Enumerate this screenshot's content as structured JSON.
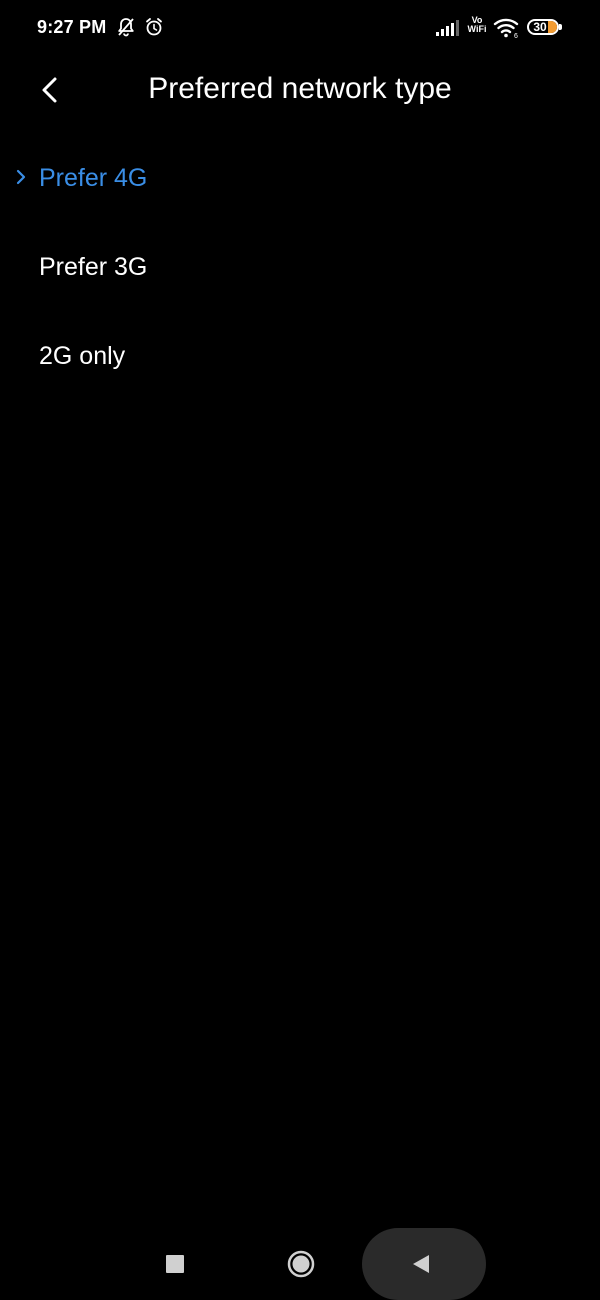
{
  "status_bar": {
    "time": "9:27 PM",
    "vowifi_line1": "Vo",
    "vowifi_line2": "WiFi",
    "battery_level": "30",
    "battery_accent": "#f39c32"
  },
  "header": {
    "title": "Preferred network type",
    "back_icon": "chevron-left-icon"
  },
  "options": [
    {
      "label": "Prefer 4G",
      "selected": true
    },
    {
      "label": "Prefer 3G",
      "selected": false
    },
    {
      "label": "2G only",
      "selected": false
    }
  ],
  "colors": {
    "background": "#000000",
    "accent": "#3a8ee6",
    "text": "#ffffff"
  },
  "nav_bar": {
    "recent_icon": "square-icon",
    "home_icon": "circle-icon",
    "back_icon": "triangle-back-icon"
  }
}
